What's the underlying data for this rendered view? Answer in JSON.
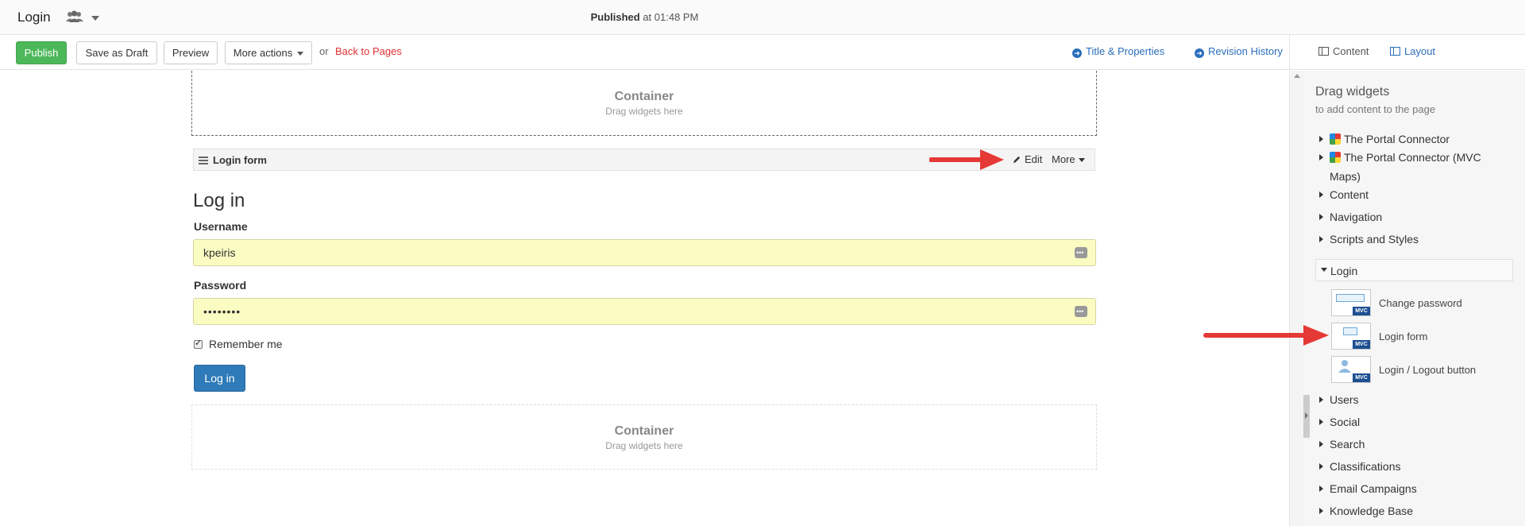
{
  "topbar": {
    "page_name": "Login",
    "status_strong": "Published",
    "status_rest": " at 01:48 PM"
  },
  "toolbar": {
    "publish_label": "Publish",
    "draft_label": "Save as Draft",
    "preview_label": "Preview",
    "more_actions_label": "More actions",
    "or_text": "or",
    "back_label": "Back to Pages",
    "title_props_label": "Title & Properties",
    "revision_label": "Revision History",
    "content_label": "Content",
    "layout_label": "Layout"
  },
  "canvas": {
    "container_title": "Container",
    "container_sub": "Drag widgets here",
    "widget_title": "Login form",
    "edit_label": "Edit",
    "more_label": "More"
  },
  "login_form": {
    "heading": "Log in",
    "username_label": "Username",
    "username_value": "kpeiris",
    "password_label": "Password",
    "password_value": "••••••••",
    "remember_label": "Remember me",
    "login_button": "Log in"
  },
  "panel": {
    "title": "Drag widgets",
    "subtitle": "to add content to the page",
    "categories_top": [
      {
        "label": "The Portal Connector"
      },
      {
        "label": "The Portal Connector (MVC"
      },
      {
        "label": "Maps)"
      },
      {
        "label": "Content"
      },
      {
        "label": "Navigation"
      },
      {
        "label": "Scripts and Styles"
      }
    ],
    "login_category": "Login",
    "login_widgets": [
      {
        "label": "Change password",
        "icon": "change-password-widget-icon",
        "badge": "MVC"
      },
      {
        "label": "Login form",
        "icon": "login-form-widget-icon",
        "badge": "MVC"
      },
      {
        "label": "Login / Logout button",
        "icon": "login-logout-widget-icon",
        "badge": "MVC"
      }
    ],
    "categories_bottom": [
      {
        "label": "Users"
      },
      {
        "label": "Social"
      },
      {
        "label": "Search"
      },
      {
        "label": "Classifications"
      },
      {
        "label": "Email Campaigns"
      },
      {
        "label": "Knowledge Base"
      }
    ]
  },
  "colors": {
    "publish_green": "#4cb85a",
    "link_blue": "#2a6ebb",
    "back_red": "#e03030",
    "field_yellow": "#fbfcc2",
    "login_button_blue": "#2f7ab8",
    "annotation_arrow_red": "#e53935"
  }
}
